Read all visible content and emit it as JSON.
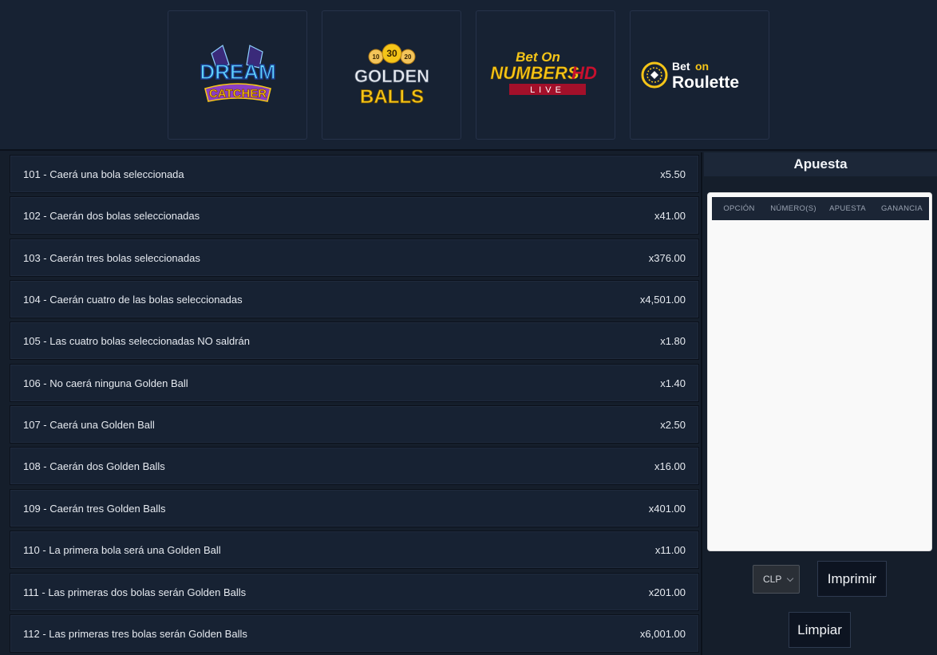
{
  "games": [
    {
      "name": "Dream Catcher",
      "icon": "dream-catcher-logo",
      "lines": [
        "DREAM",
        "CATCHER"
      ]
    },
    {
      "name": "Golden Balls",
      "icon": "golden-balls-logo",
      "balls": [
        "10",
        "30",
        "20"
      ],
      "lines": [
        "GOLDEN",
        "BALLS"
      ]
    },
    {
      "name": "Bet On Numbers HD Live",
      "icon": "bet-on-numbers-logo",
      "lines": [
        "Bet On",
        "NUMBERS",
        "HD",
        "LIVE"
      ]
    },
    {
      "name": "Bet on Roulette",
      "icon": "bet-on-roulette-logo",
      "lines": [
        "Bet",
        "on",
        "Roulette"
      ]
    }
  ],
  "bets": [
    {
      "label": "101 - Caerá una bola seleccionada",
      "odds": "x5.50"
    },
    {
      "label": "102 - Caerán dos bolas seleccionadas",
      "odds": "x41.00"
    },
    {
      "label": "103 - Caerán tres bolas seleccionadas",
      "odds": "x376.00"
    },
    {
      "label": "104 - Caerán cuatro de las bolas seleccionadas",
      "odds": "x4,501.00"
    },
    {
      "label": "105 - Las cuatro bolas seleccionadas NO saldrán",
      "odds": "x1.80"
    },
    {
      "label": "106 - No caerá ninguna Golden Ball",
      "odds": "x1.40"
    },
    {
      "label": "107 - Caerá una Golden Ball",
      "odds": "x2.50"
    },
    {
      "label": "108 - Caerán dos Golden Balls",
      "odds": "x16.00"
    },
    {
      "label": "109 - Caerán tres Golden Balls",
      "odds": "x401.00"
    },
    {
      "label": "110 - La primera bola será una Golden Ball",
      "odds": "x11.00"
    },
    {
      "label": "111 - Las primeras dos bolas serán Golden Balls",
      "odds": "x201.00"
    },
    {
      "label": "112 - Las primeras tres bolas serán Golden Balls",
      "odds": "x6,001.00"
    }
  ],
  "slip": {
    "title": "Apuesta",
    "columns": [
      "OPCIÓN",
      "NÚMERO(S)",
      "APUESTA",
      "GANANCIA"
    ],
    "currency": "CLP",
    "print_label": "Imprimir",
    "clear_label": "Limpiar"
  },
  "colors": {
    "background": "#151e2b",
    "card": "#172233",
    "accent_gold": "#f5c518",
    "accent_purple": "#7b3fb0"
  }
}
